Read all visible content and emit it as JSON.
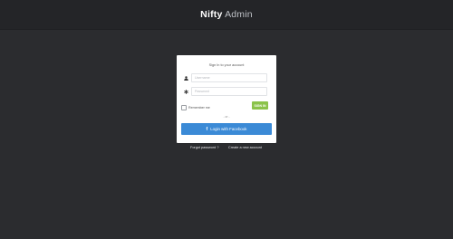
{
  "header": {
    "brand_strong": "Nifty",
    "brand_light": "Admin"
  },
  "login": {
    "title": "Sign In to your account",
    "username_placeholder": "Username",
    "password_placeholder": "Password",
    "remember_label": "Remember me",
    "remember_checked": false,
    "signin_label": "SIGN IN",
    "divider_text": "- or -",
    "facebook_label": "Login with Facebook",
    "facebook_icon": "facebook-f-icon",
    "user_icon": "user-icon",
    "password_icon": "asterisk-icon"
  },
  "links": {
    "forgot_password": "Forgot password ?",
    "create_account": "Create a new account"
  },
  "colors": {
    "background": "#2b2c2f",
    "topbar": "#242528",
    "signin_button": "#8bc34a",
    "facebook_button": "#3b8ad6"
  }
}
